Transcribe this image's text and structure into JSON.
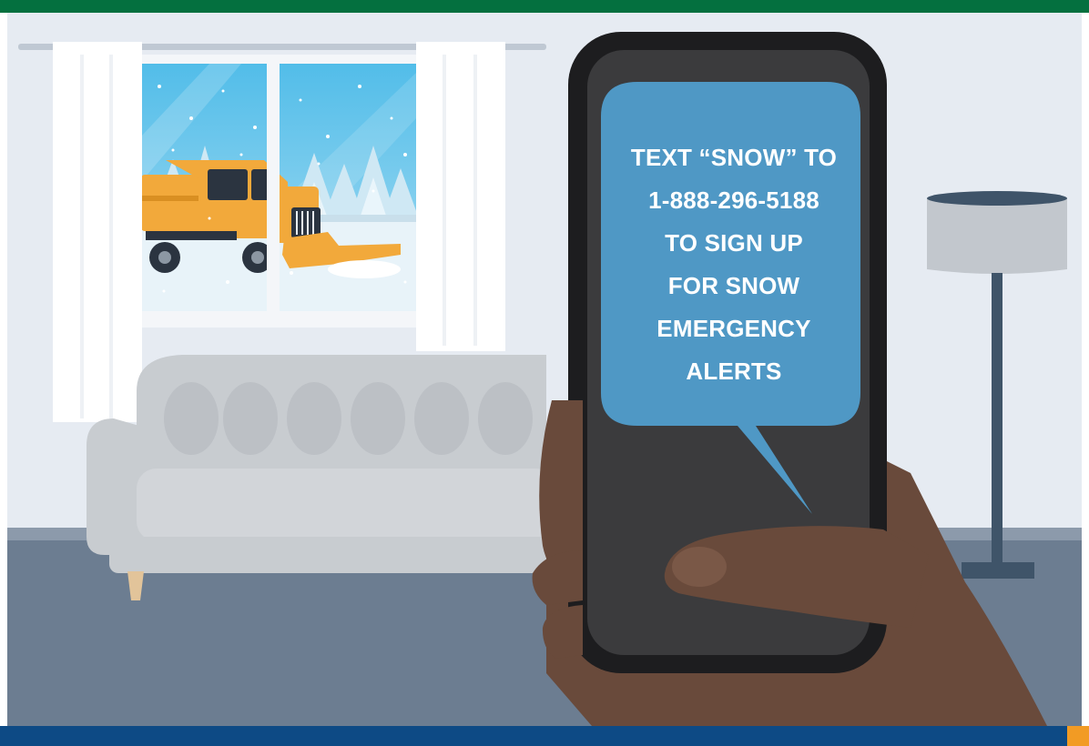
{
  "colors": {
    "top_bar": "#04703f",
    "bottom_bar": "#0d4a85",
    "corner_accent": "#f29b24",
    "bubble": "#4f98c5",
    "plow_truck": "#f2a93b"
  },
  "phone": {
    "message": "TEXT “SNOW” TO\n1-888-296-5188\nTO SIGN UP\nFOR SNOW\nEMERGENCY\nALERTS"
  }
}
